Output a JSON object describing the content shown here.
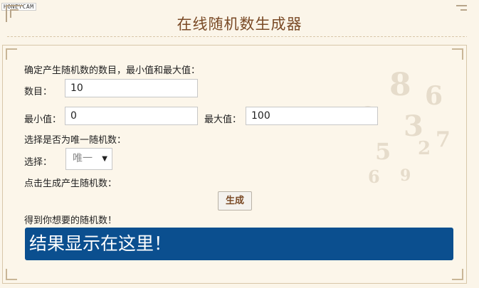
{
  "watermark": "HONEYCAM",
  "page_title": "在线随机数生成器",
  "form": {
    "intro": "确定产生随机数的数目，最小值和最大值：",
    "count_label": "数目：",
    "count_value": "10",
    "min_label": "最小值：",
    "min_value": "0",
    "max_label": "最大值：",
    "max_value": "100",
    "unique_prompt": "选择是否为唯一随机数：",
    "select_label": "选择：",
    "select_value": "唯一",
    "generate_prompt": "点击生成产生随机数：",
    "generate_button": "生成",
    "result_label": "得到你想要的随机数！",
    "result_text": "结果显示在这里！"
  }
}
